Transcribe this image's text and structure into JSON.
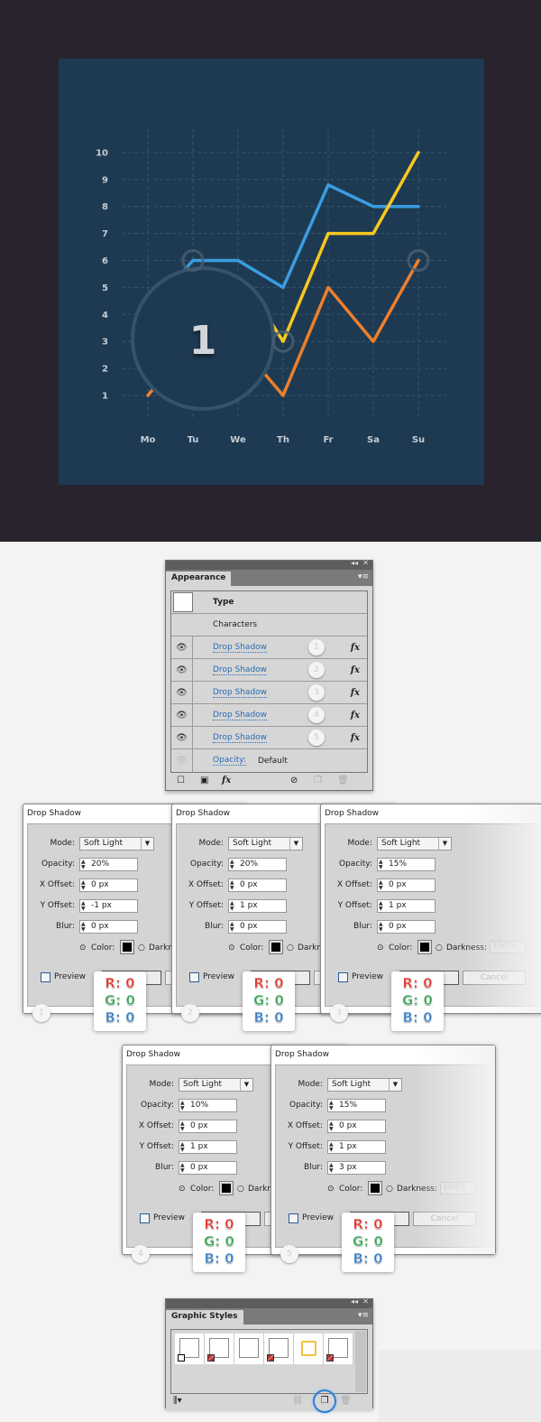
{
  "chart_data": {
    "type": "line",
    "categories": [
      "Mo",
      "Tu",
      "We",
      "Th",
      "Fr",
      "Sa",
      "Su"
    ],
    "yticks": [
      "1",
      "2",
      "3",
      "4",
      "5",
      "6",
      "7",
      "8",
      "9",
      "10"
    ],
    "ylim": [
      0,
      10.5
    ],
    "grid": true,
    "series": [
      {
        "color": "#3a9ee0",
        "values": [
          null,
          6,
          6,
          5,
          8.8,
          8,
          8
        ]
      },
      {
        "color": "#f8c81f",
        "values": [
          null,
          null,
          null,
          3,
          7,
          7,
          10
        ]
      },
      {
        "color": "#ee7f2c",
        "values": [
          1,
          null,
          null,
          1,
          5,
          3,
          6
        ]
      }
    ],
    "markers": [
      {
        "x": "Tu",
        "y": 6
      },
      {
        "x": "Th",
        "y": 3
      },
      {
        "x": "Su",
        "y": 6
      }
    ],
    "overlay_label": "1",
    "background": "#1e3a52"
  },
  "appearance": {
    "tab": "Appearance",
    "type_label": "Type",
    "characters_label": "Characters",
    "effects": [
      {
        "label": "Drop Shadow",
        "num": "1",
        "fx": "fx"
      },
      {
        "label": "Drop Shadow",
        "num": "2",
        "fx": "fx"
      },
      {
        "label": "Drop Shadow",
        "num": "3",
        "fx": "fx"
      },
      {
        "label": "Drop Shadow",
        "num": "4",
        "fx": "fx"
      },
      {
        "label": "Drop Shadow",
        "num": "5",
        "fx": "fx"
      }
    ],
    "opacity_label": "Opacity:",
    "opacity_value": "Default",
    "fx_button": "fx"
  },
  "dialogs": [
    {
      "title": "Drop Shadow",
      "mode": "Soft Light",
      "opacity": "20%",
      "x": "0 px",
      "y": "-1 px",
      "blur": "0 px",
      "num": "1"
    },
    {
      "title": "Drop Shadow",
      "mode": "Soft Light",
      "opacity": "20%",
      "x": "0 px",
      "y": "1 px",
      "blur": "0 px",
      "num": "2"
    },
    {
      "title": "Drop Shadow",
      "mode": "Soft Light",
      "opacity": "15%",
      "x": "0 px",
      "y": "1 px",
      "blur": "0 px",
      "num": "3"
    },
    {
      "title": "Drop Shadow",
      "mode": "Soft Light",
      "opacity": "10%",
      "x": "0 px",
      "y": "1 px",
      "blur": "0 px",
      "num": "4"
    },
    {
      "title": "Drop Shadow",
      "mode": "Soft Light",
      "opacity": "15%",
      "x": "0 px",
      "y": "1 px",
      "blur": "3 px",
      "num": "5"
    }
  ],
  "dialog_labels": {
    "mode": "Mode:",
    "opacity": "Opacity:",
    "x": "X Offset:",
    "y": "Y Offset:",
    "blur": "Blur:",
    "color": "Color:",
    "darkness": "Darkness:",
    "darkness_value": "100%",
    "preview": "Preview",
    "cancel": "Cancel"
  },
  "rgb": {
    "r": "R: 0",
    "g": "G: 0",
    "b": "B: 0",
    "r_color": "#e03a33",
    "g_color": "#3aa657",
    "b_color": "#3b7fc4"
  },
  "graphic_styles": {
    "tab": "Graphic Styles"
  }
}
